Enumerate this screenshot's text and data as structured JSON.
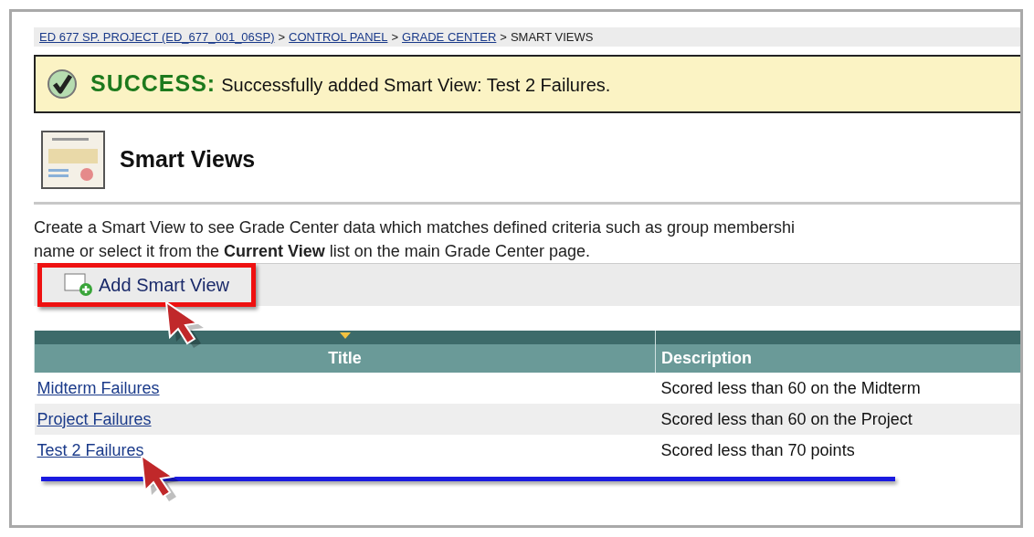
{
  "breadcrumb": {
    "links": [
      "ED 677 SP. PROJECT (ED_677_001_06SP)",
      "CONTROL PANEL",
      "GRADE CENTER"
    ],
    "separator": ">",
    "current": "SMART VIEWS"
  },
  "banner": {
    "kind": "success",
    "label": "SUCCESS:",
    "message": "Successfully added Smart View: Test 2 Failures."
  },
  "page_title": "Smart Views",
  "description": "Create a Smart View to see Grade Center data which matches defined criteria such as group membershi\nname or select it from the **Current View** list on the main Grade Center page.",
  "toolbar": {
    "button": "Add Smart View"
  },
  "table": {
    "columns": [
      {
        "label": "Title",
        "sorted": true
      },
      {
        "label": "Description",
        "sorted": false
      }
    ],
    "rows": [
      {
        "title": "Midterm Failures",
        "description": "Scored less than 60 on the Midterm"
      },
      {
        "title": "Project Failures",
        "description": "Scored less than 60 on the Project"
      },
      {
        "title": "Test 2 Failures",
        "description": "Scored less than 70 points"
      }
    ]
  }
}
